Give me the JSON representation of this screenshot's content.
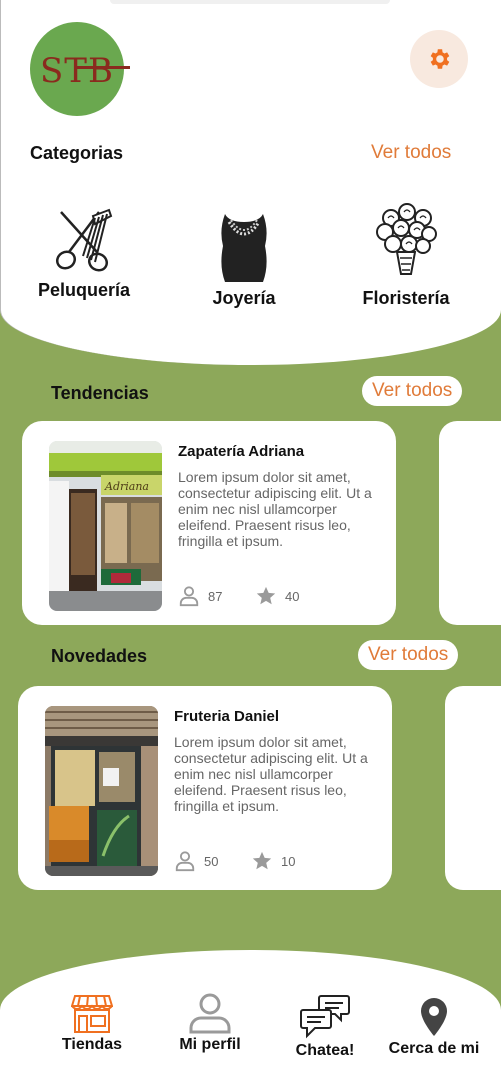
{
  "brand": {
    "logo_text": "STB"
  },
  "colors": {
    "accent": "#e07b39",
    "green": "#8da85a",
    "logo_green": "#6aa84f"
  },
  "categories": {
    "title": "Categorias",
    "see_all": "Ver todos",
    "items": [
      {
        "label": "Peluquería",
        "icon": "scissors-comb-icon"
      },
      {
        "label": "Joyería",
        "icon": "necklace-icon"
      },
      {
        "label": "Floristería",
        "icon": "bouquet-icon"
      }
    ]
  },
  "trends": {
    "title": "Tendencias",
    "see_all": "Ver todos",
    "card": {
      "name": "Zapatería Adriana",
      "sign_text": "Adriana",
      "description": "Lorem ipsum dolor sit amet, consectetur adipiscing elit. Ut a enim nec nisl ullamcorper eleifend. Praesent risus leo, fringilla et ipsum.",
      "followers": "87",
      "rating": "40"
    }
  },
  "news": {
    "title": "Novedades",
    "see_all": "Ver todos",
    "card": {
      "name": "Fruteria Daniel",
      "description": "Lorem ipsum dolor sit amet, consectetur adipiscing elit. Ut a enim nec nisl ullamcorper eleifend. Praesent risus leo, fringilla et ipsum.",
      "followers": "50",
      "rating": "10"
    }
  },
  "nav": {
    "items": [
      {
        "label": "Tiendas",
        "icon": "store-icon",
        "active": true
      },
      {
        "label": "Mi perfil",
        "icon": "user-icon"
      },
      {
        "label": "Chatea!",
        "icon": "chat-icon"
      },
      {
        "label": "Cerca de mi",
        "icon": "location-pin-icon"
      }
    ]
  }
}
